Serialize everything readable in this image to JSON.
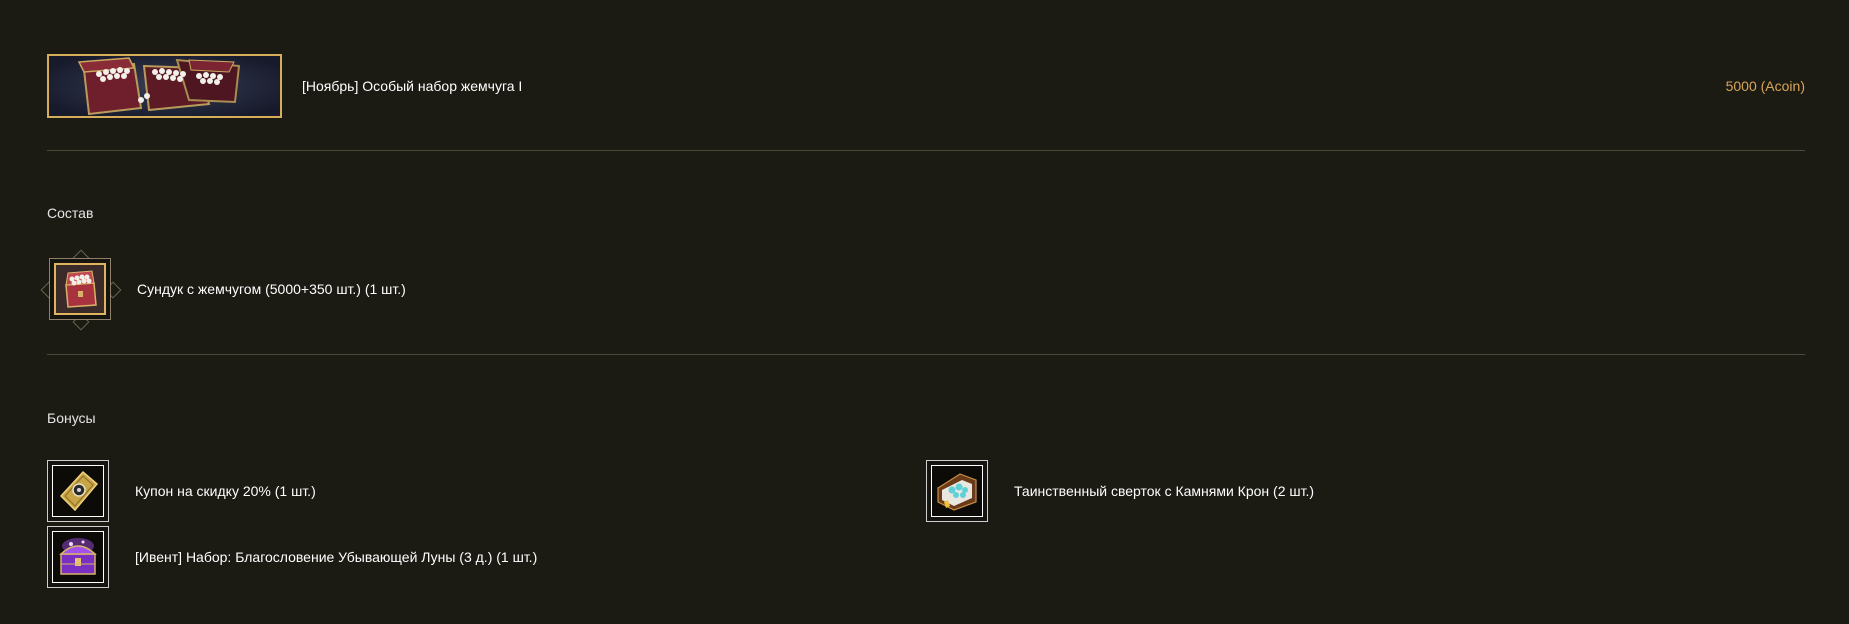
{
  "header": {
    "title": "[Ноябрь] Особый набор жемчуга I",
    "price": "5000 (Acoin)",
    "banner_icon": "pearl-chests-banner"
  },
  "composition": {
    "title": "Состав",
    "items": [
      {
        "label": "Сундук с жемчугом (5000+350 шт.) (1 шт.)",
        "icon": "pearl-chest-icon"
      }
    ]
  },
  "bonuses": {
    "title": "Бонусы",
    "items": [
      {
        "label": "Купон на скидку 20% (1 шт.)",
        "icon": "discount-coupon-icon"
      },
      {
        "label": "Таинственный сверток с Камнями Крон (2 шт.)",
        "icon": "crown-stones-bundle-icon"
      },
      {
        "label": "[Ивент] Набор: Благословение Убывающей Луны (3 д.) (1 шт.)",
        "icon": "purple-chest-icon"
      }
    ]
  },
  "colors": {
    "background": "#1b1a13",
    "accent_gold": "#d6ad5b",
    "price": "#d9a55a",
    "divider": "#4a4838"
  }
}
